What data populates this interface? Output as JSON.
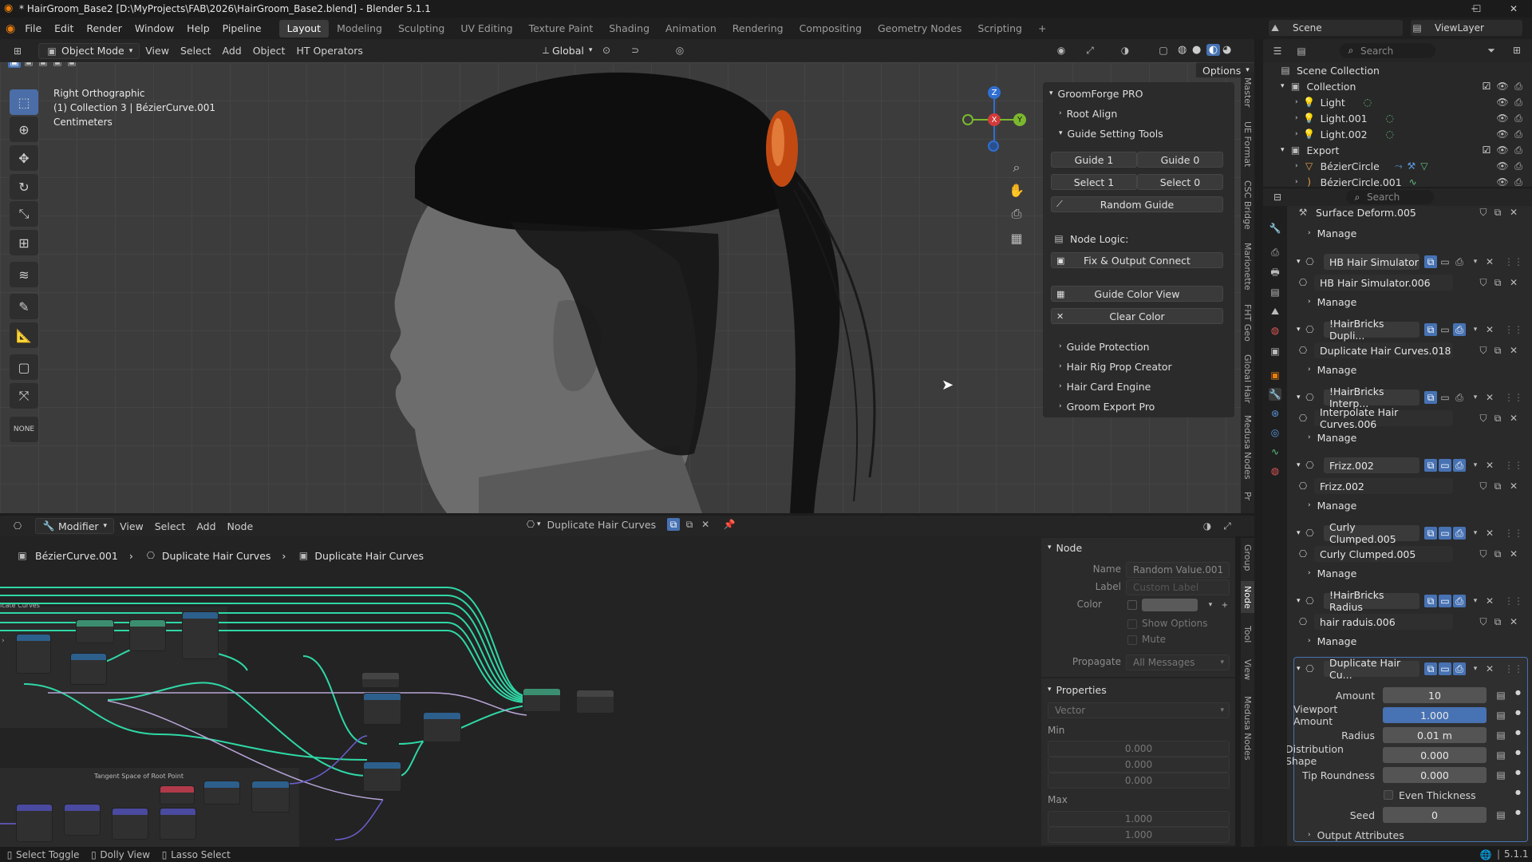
{
  "window": {
    "title": "* HairGroom_Base2 [D:\\MyProjects\\FAB\\2026\\HairGroom_Base2.blend] - Blender 5.1.1",
    "controls": [
      "minimize-icon",
      "maximize-icon",
      "close-icon"
    ]
  },
  "menu": {
    "items": [
      "File",
      "Edit",
      "Render",
      "Window",
      "Help",
      "Pipeline"
    ],
    "workspaces": [
      "Layout",
      "Modeling",
      "Sculpting",
      "UV Editing",
      "Texture Paint",
      "Shading",
      "Animation",
      "Rendering",
      "Compositing",
      "Geometry Nodes",
      "Scripting"
    ],
    "active_workspace": "Layout",
    "scene": "Scene",
    "viewlayer": "ViewLayer"
  },
  "viewport_header": {
    "mode": "Object Mode",
    "menus": [
      "View",
      "Select",
      "Add",
      "Object",
      "HT Operators"
    ],
    "orientation": "Global",
    "options": "Options"
  },
  "viewport_info": {
    "line1": "Right Orthographic",
    "line2": "(1) Collection 3 | BézierCurve.001",
    "line3": "Centimeters"
  },
  "gizmo": {
    "z": "Z",
    "y": "Y",
    "x": "X"
  },
  "npanel": {
    "title": "GroomForge PRO",
    "root_align": "Root Align",
    "guide_setting_tools": "Guide Setting Tools",
    "guide1": "Guide 1",
    "guide0": "Guide 0",
    "select1": "Select 1",
    "select0": "Select 0",
    "random_guide": "Random Guide",
    "node_logic": "Node Logic:",
    "fix_output": "Fix & Output Connect",
    "guide_color_view": "Guide Color View",
    "clear_color": "Clear Color",
    "sections": [
      "Guide Protection",
      "Hair Rig Prop Creator",
      "Hair Card Engine",
      "Groom Export Pro"
    ]
  },
  "viewport_tabs": [
    "Master",
    "UE Format",
    "CSC Bridge",
    "Marionette",
    "FHT Geo",
    "Global Hair",
    "Medusa Nodes",
    "Pr"
  ],
  "node_header": {
    "editor": "Modifier",
    "menus": [
      "View",
      "Select",
      "Add",
      "Node"
    ],
    "tree_name": "Duplicate Hair Curves"
  },
  "breadcrumb": [
    "BézierCurve.001",
    "Duplicate Hair Curves",
    "Duplicate Hair Curves"
  ],
  "node_frames": [
    "icate Curves",
    "Tangent Space of Root Point"
  ],
  "node_sidebar": {
    "node_title": "Node",
    "name_label": "Name",
    "name_value": "Random Value.001",
    "label_label": "Label",
    "label_placeholder": "Custom Label",
    "color_label": "Color",
    "show_options": "Show Options",
    "mute": "Mute",
    "propagate_label": "Propagate",
    "propagate_value": "All Messages",
    "properties_title": "Properties",
    "type_value": "Vector",
    "min_label": "Min",
    "min_values": [
      "0.000",
      "0.000",
      "0.000"
    ],
    "max_label": "Max",
    "max_values": [
      "1.000",
      "1.000"
    ]
  },
  "node_tabs": [
    "Group",
    "Node",
    "Tool",
    "View",
    "Medusa Nodes"
  ],
  "outliner": {
    "search_placeholder": "Search",
    "scene_collection": "Scene Collection",
    "rows": [
      {
        "label": "Collection",
        "indent": 1
      },
      {
        "label": "Light",
        "indent": 2
      },
      {
        "label": "Light.001",
        "indent": 2
      },
      {
        "label": "Light.002",
        "indent": 2
      },
      {
        "label": "Export",
        "indent": 1
      },
      {
        "label": "BézierCircle",
        "indent": 2
      },
      {
        "label": "BézierCircle.001",
        "indent": 2
      }
    ]
  },
  "properties": {
    "search_placeholder": "Search",
    "manage": "Manage",
    "modifiers": [
      {
        "name": "Surface Deform.005",
        "group": null
      },
      {
        "name": "HB Hair Simulator",
        "group": "HB Hair Simulator.006"
      },
      {
        "name": "!HairBricks Dupli...",
        "group": "Duplicate Hair Curves.018"
      },
      {
        "name": "!HairBricks Interp...",
        "group": "Interpolate Hair Curves.006"
      },
      {
        "name": "Frizz.002",
        "group": "Frizz.002"
      },
      {
        "name": "Curly Clumped.005",
        "group": "Curly Clumped.005"
      },
      {
        "name": "!HairBricks Radius",
        "group": "hair raduis.006"
      },
      {
        "name": "Duplicate Hair Cu...",
        "group": null
      }
    ],
    "params": [
      {
        "label": "Amount",
        "value": "10"
      },
      {
        "label": "Viewport Amount",
        "value": "1.000"
      },
      {
        "label": "Radius",
        "value": "0.01 m"
      },
      {
        "label": "Distribution Shape",
        "value": "0.000"
      },
      {
        "label": "Tip Roundness",
        "value": "0.000"
      }
    ],
    "even_thickness": "Even Thickness",
    "seed_label": "Seed",
    "seed_value": "0",
    "output_attributes": "Output Attributes"
  },
  "status": {
    "select_toggle": "Select Toggle",
    "dolly_view": "Dolly View",
    "lasso_select": "Lasso Select",
    "version": "5.1.1"
  }
}
